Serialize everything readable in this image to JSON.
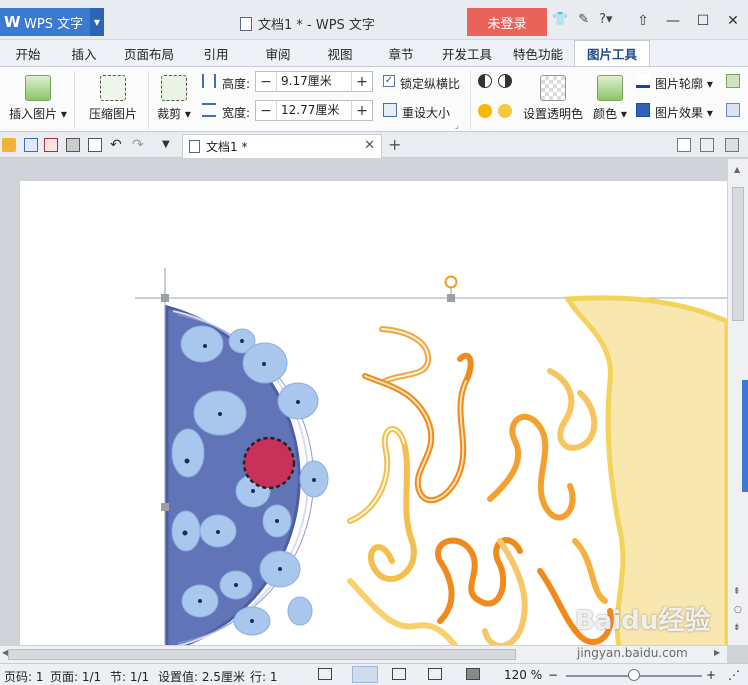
{
  "titlebar": {
    "app_name": "WPS 文字",
    "doc_title": "文档1 * - WPS 文字",
    "login_label": "未登录",
    "help_label": "?",
    "window_controls": [
      "minimize-icon",
      "maximize-icon",
      "close-icon"
    ]
  },
  "tabs": [
    {
      "label": "开始",
      "active": false
    },
    {
      "label": "插入",
      "active": false
    },
    {
      "label": "页面布局",
      "active": false
    },
    {
      "label": "引用",
      "active": false
    },
    {
      "label": "审阅",
      "active": false
    },
    {
      "label": "视图",
      "active": false
    },
    {
      "label": "章节",
      "active": false
    },
    {
      "label": "开发工具",
      "active": false
    },
    {
      "label": "特色功能",
      "active": false
    },
    {
      "label": "图片工具",
      "active": true
    }
  ],
  "ribbon": {
    "insert_picture": "插入图片",
    "compress_picture": "压缩图片",
    "crop": "裁剪",
    "height_label": "高度:",
    "height_value": "9.17厘米",
    "width_label": "宽度:",
    "width_value": "12.77厘米",
    "lock_ratio": "锁定纵横比",
    "lock_ratio_checked": true,
    "reset_size": "重设大小",
    "set_transparent": "设置透明色",
    "color": "颜色",
    "picture_outline": "图片轮廓",
    "picture_effect": "图片效果"
  },
  "doc_tab": {
    "label": "文档1 *"
  },
  "status": {
    "page_no": "页码: 1",
    "pages": "页面: 1/1",
    "section": "节: 1/1",
    "set_value": "设置值: 2.5厘米",
    "row": "行: 1",
    "zoom": "120 %"
  },
  "watermark": {
    "logo": "Baidu经验",
    "url": "jingyan.baidu.com"
  },
  "colors": {
    "app_blue": "#3a7ad0",
    "login_red": "#e8645a",
    "cell_nucleus": "#6274b8",
    "chromatin": "#a9c7ec",
    "nucleolus": "#c8325a",
    "er_orange": "#f08a1c",
    "membrane_yellow": "#f8e7ae"
  }
}
